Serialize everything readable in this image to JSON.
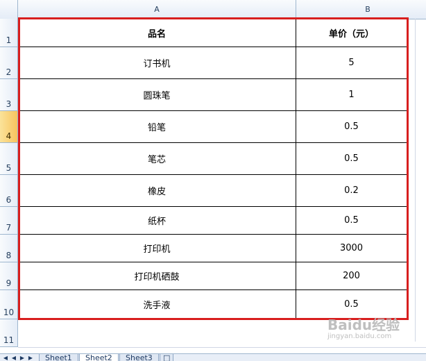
{
  "columns": [
    "A",
    "B"
  ],
  "rows": [
    "1",
    "2",
    "3",
    "4",
    "5",
    "6",
    "7",
    "8",
    "9",
    "10",
    "11"
  ],
  "active_row": "4",
  "table": {
    "header": [
      "品名",
      "单价（元）"
    ],
    "items": [
      [
        "订书机",
        "5"
      ],
      [
        "圆珠笔",
        "1"
      ],
      [
        "铅笔",
        "0.5"
      ],
      [
        "笔芯",
        "0.5"
      ],
      [
        "橡皮",
        "0.2"
      ],
      [
        "纸杯",
        "0.5"
      ],
      [
        "打印机",
        "3000"
      ],
      [
        "打印机硒鼓",
        "200"
      ],
      [
        "洗手液",
        "0.5"
      ]
    ]
  },
  "sheet_tabs": [
    "Sheet1",
    "Sheet2",
    "Sheet3"
  ],
  "active_sheet": "Sheet2",
  "nav_icons": [
    "first-sheet-icon",
    "prev-sheet-icon",
    "next-sheet-icon",
    "last-sheet-icon"
  ],
  "highlight_color": "#d81e1e",
  "watermark": {
    "logo": "Baidu经验",
    "url": "jingyan.baidu.com"
  }
}
